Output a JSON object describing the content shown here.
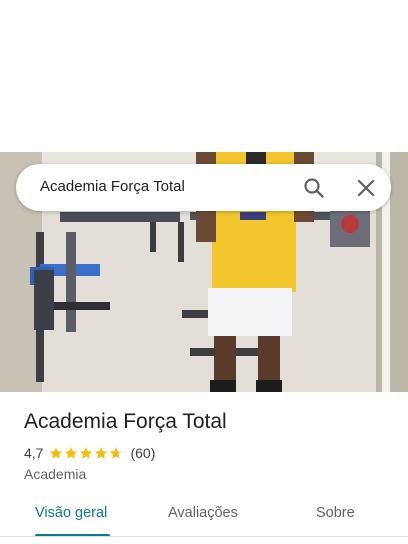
{
  "search": {
    "query": "Academia Força Total",
    "search_icon": "search-icon",
    "close_icon": "close-icon"
  },
  "place": {
    "name": "Academia Força Total",
    "rating": "4,7",
    "rating_value": 4.7,
    "review_count": "(60)",
    "category": "Academia"
  },
  "tabs": [
    {
      "label": "Visão geral",
      "active": true
    },
    {
      "label": "Avaliações",
      "active": false
    },
    {
      "label": "Sobre",
      "active": false
    }
  ],
  "colors": {
    "accent": "#0b7a8a",
    "star": "#fbbc04"
  }
}
